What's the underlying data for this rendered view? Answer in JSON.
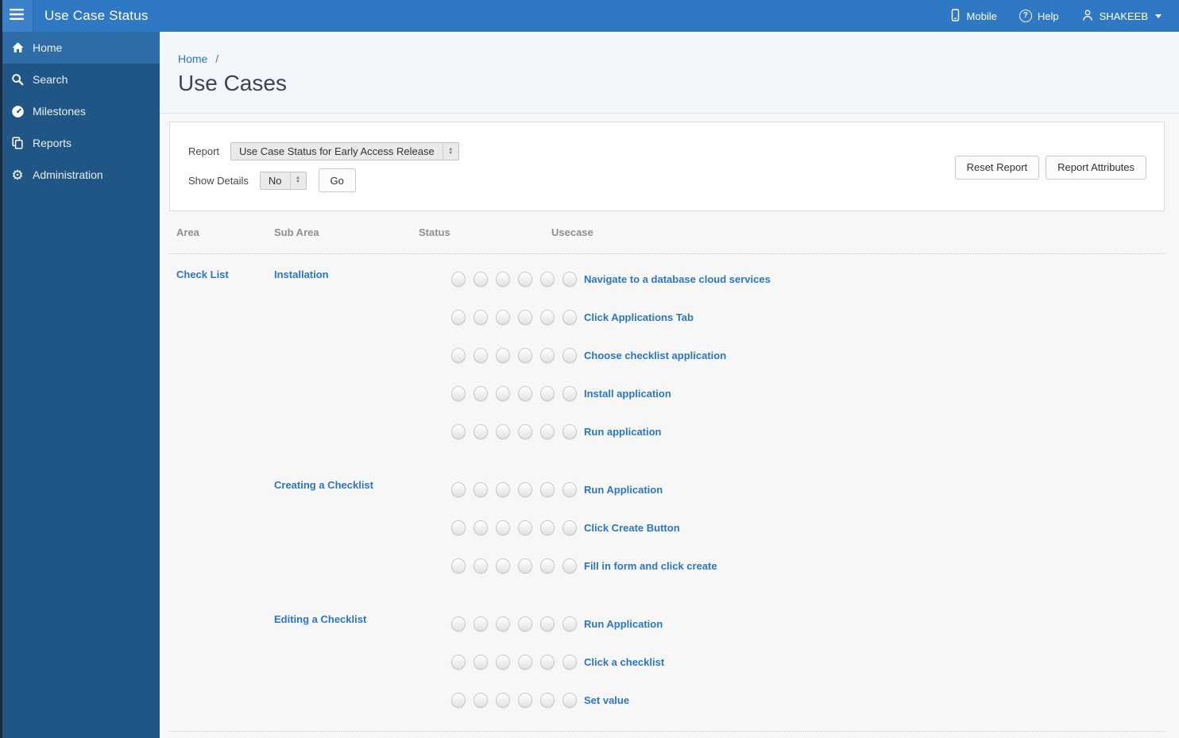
{
  "topbar": {
    "title": "Use Case Status",
    "mobile_label": "Mobile",
    "help_label": "Help",
    "user_name": "SHAKEEB"
  },
  "sidebar": {
    "items": [
      {
        "label": "Home",
        "icon": "home-icon",
        "active": true
      },
      {
        "label": "Search",
        "icon": "search-icon",
        "active": false
      },
      {
        "label": "Milestones",
        "icon": "milestones-icon",
        "active": false
      },
      {
        "label": "Reports",
        "icon": "reports-icon",
        "active": false
      },
      {
        "label": "Administration",
        "icon": "gear-icon",
        "active": false
      }
    ]
  },
  "breadcrumb": {
    "home": "Home",
    "separator": "/"
  },
  "page": {
    "title": "Use Cases"
  },
  "report_form": {
    "report_label": "Report",
    "report_value": "Use Case Status for Early Access Release",
    "show_details_label": "Show Details",
    "show_details_value": "No",
    "go_label": "Go",
    "reset_label": "Reset Report",
    "attributes_label": "Report Attributes"
  },
  "table": {
    "headers": [
      "Area",
      "Sub Area",
      "Status",
      "Usecase"
    ],
    "area": "Check List",
    "status_slots": 6,
    "groups": [
      {
        "sub_area": "Installation",
        "usecases": [
          "Navigate to a database cloud services",
          "Click Applications Tab",
          "Choose checklist application",
          "Install application",
          "Run application"
        ]
      },
      {
        "sub_area": "Creating a Checklist",
        "usecases": [
          "Run Application",
          "Click Create Button",
          "Fill in form and click create"
        ]
      },
      {
        "sub_area": "Editing a Checklist",
        "usecases": [
          "Run Application",
          "Click a checklist",
          "Set value"
        ]
      }
    ]
  },
  "icons": {
    "help_glyph": "?",
    "gear_glyph": "⚙",
    "spinner_up": "▲",
    "spinner_down": "▼"
  },
  "colors": {
    "topbar": "#2e78c4",
    "sidebar": "#1f5685",
    "sidebar_active": "#2d6ca7",
    "link": "#2b76c4",
    "header_band": "#f3f6fb",
    "content_bg": "#f7f7f7"
  }
}
